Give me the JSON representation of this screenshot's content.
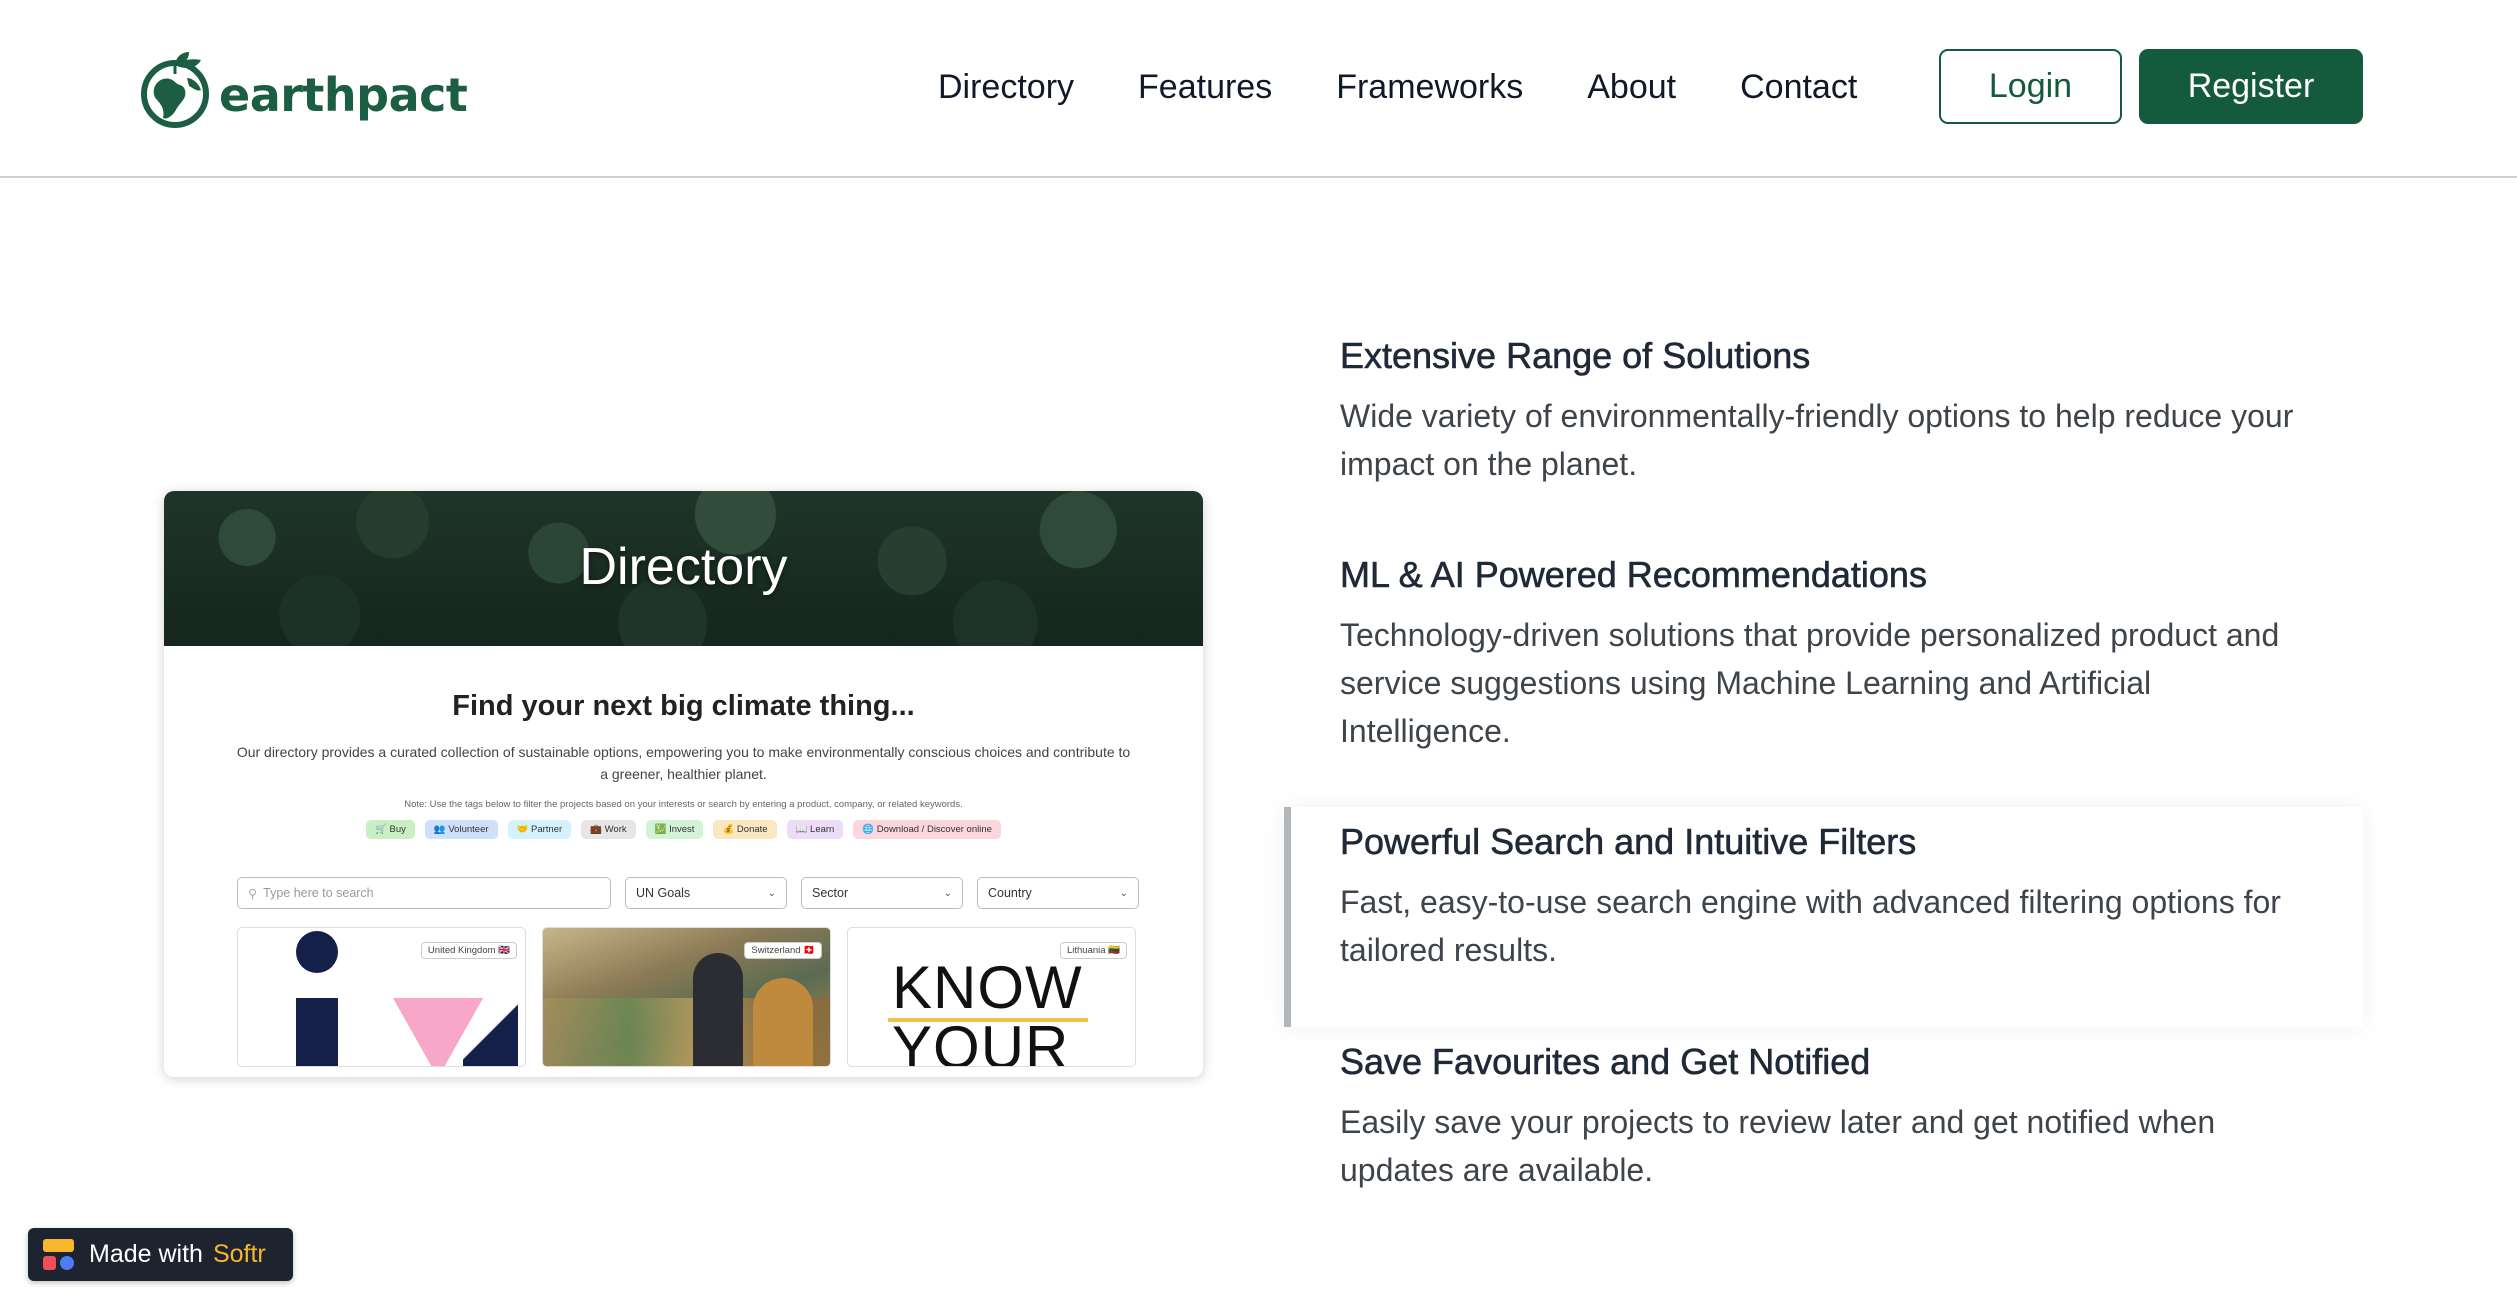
{
  "brand": {
    "name": "earthpact",
    "color": "#1b5e43"
  },
  "nav": {
    "items": [
      "Directory",
      "Features",
      "Frameworks",
      "About",
      "Contact"
    ],
    "login_label": "Login",
    "register_label": "Register"
  },
  "preview": {
    "banner_title": "Directory",
    "heading": "Find your next big climate thing...",
    "description": "Our directory provides a curated collection of sustainable options, empowering you to make environmentally conscious choices and contribute to a greener, healthier planet.",
    "note": "Note: Use the tags below to filter the projects based on your interests or search by entering a product, company, or related keywords.",
    "tags": [
      {
        "label": "🛒 Buy",
        "color": "#c9f0c3"
      },
      {
        "label": "👥 Volunteer",
        "color": "#cfe0fb"
      },
      {
        "label": "🤝 Partner",
        "color": "#d4f2fb"
      },
      {
        "label": "💼 Work",
        "color": "#e6e6e6"
      },
      {
        "label": "💹 Invest",
        "color": "#d2f3d7"
      },
      {
        "label": "💰 Donate",
        "color": "#fbe7c0"
      },
      {
        "label": "📖 Learn",
        "color": "#ebdcf8"
      },
      {
        "label": "🌐 Download / Discover online",
        "color": "#fbd6dc"
      }
    ],
    "search_placeholder": "Type here to search",
    "filters": [
      "UN Goals",
      "Sector",
      "Country"
    ],
    "cards": [
      {
        "badge": "United Kingdom 🇬🇧"
      },
      {
        "badge": "Switzerland 🇨🇭"
      },
      {
        "badge": "Lithuania 🇱🇹",
        "text_line1": "KNOW",
        "text_line2": "YOUR"
      }
    ]
  },
  "features": [
    {
      "title": "Extensive Range of Solutions",
      "description": "Wide variety of environmentally-friendly options to help reduce your impact on the planet."
    },
    {
      "title": "ML & AI Powered Recommendations",
      "description": "Technology-driven solutions that provide personalized product and service suggestions using Machine Learning and Artificial Intelligence."
    },
    {
      "title": "Powerful Search and Intuitive Filters",
      "description": "Fast, easy-to-use search engine with advanced filtering options for tailored results.",
      "active": true
    },
    {
      "title": "Save Favourites and Get Notified",
      "description": "Easily save your projects to review later and get notified when updates are available."
    }
  ],
  "badge": {
    "prefix": "Made with",
    "brand": "Softr"
  }
}
